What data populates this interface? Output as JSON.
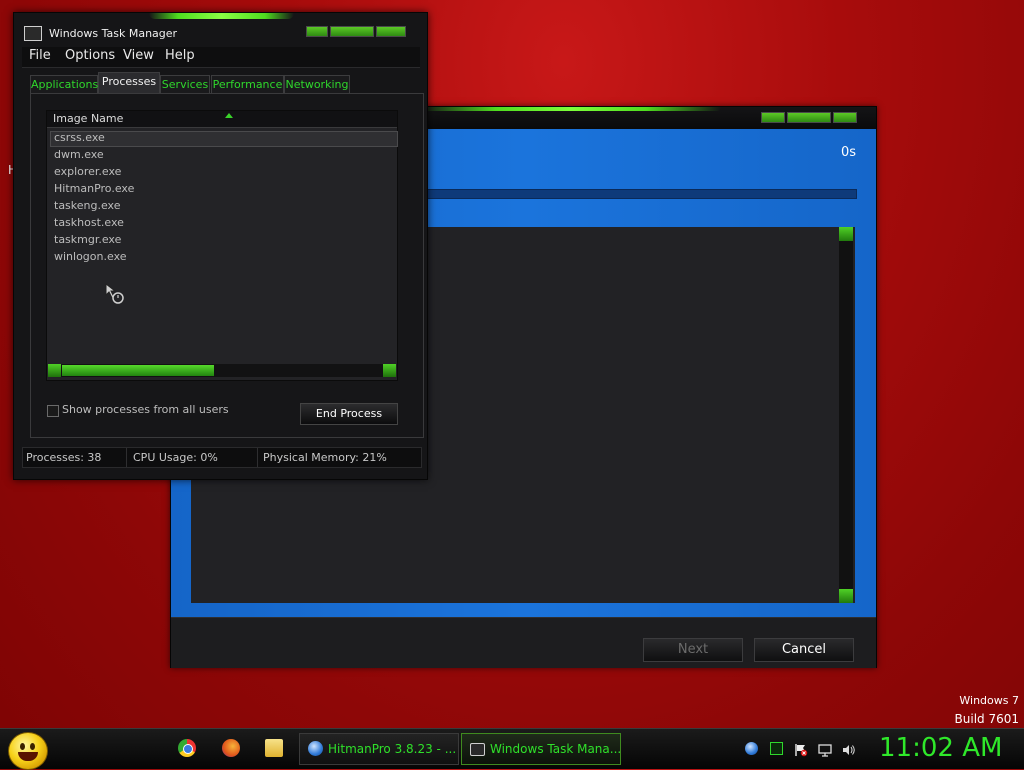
{
  "hitmanpro": {
    "elapsed": "0s",
    "buttons": {
      "next": "Next",
      "cancel": "Cancel"
    }
  },
  "taskmgr": {
    "title": "Windows Task Manager",
    "menu": [
      "File",
      "Options",
      "View",
      "Help"
    ],
    "tabs": [
      "Applications",
      "Processes",
      "Services",
      "Performance",
      "Networking"
    ],
    "active_tab": "Processes",
    "column_header": "Image Name",
    "processes": [
      "csrss.exe",
      "dwm.exe",
      "explorer.exe",
      "HitmanPro.exe",
      "taskeng.exe",
      "taskhost.exe",
      "taskmgr.exe",
      "winlogon.exe"
    ],
    "show_all_label": "Show processes from all users",
    "show_all_checked": false,
    "end_process_label": "End Process",
    "status": {
      "processes": "Processes: 38",
      "cpu": "CPU Usage: 0%",
      "memory": "Physical Memory: 21%"
    }
  },
  "desktop": {
    "edge_letter": "H",
    "os_name": "Windows 7",
    "build": "Build 7601"
  },
  "taskbar": {
    "quick_launch": [
      "chrome-icon",
      "firefox-icon",
      "folder-icon"
    ],
    "tasks": [
      {
        "label": "HitmanPro 3.8.23 - ...",
        "active": false
      },
      {
        "label": "Windows Task Mana...",
        "active": true
      }
    ],
    "tray_icons": [
      "network-globe-icon",
      "green-square-icon",
      "flag-icon",
      "monitor-icon",
      "volume-icon"
    ],
    "clock": "11:02 AM"
  },
  "colors": {
    "accent_green": "#2fe02a",
    "desktop_red": "#a80c0c",
    "hitman_blue": "#1b74dc"
  }
}
